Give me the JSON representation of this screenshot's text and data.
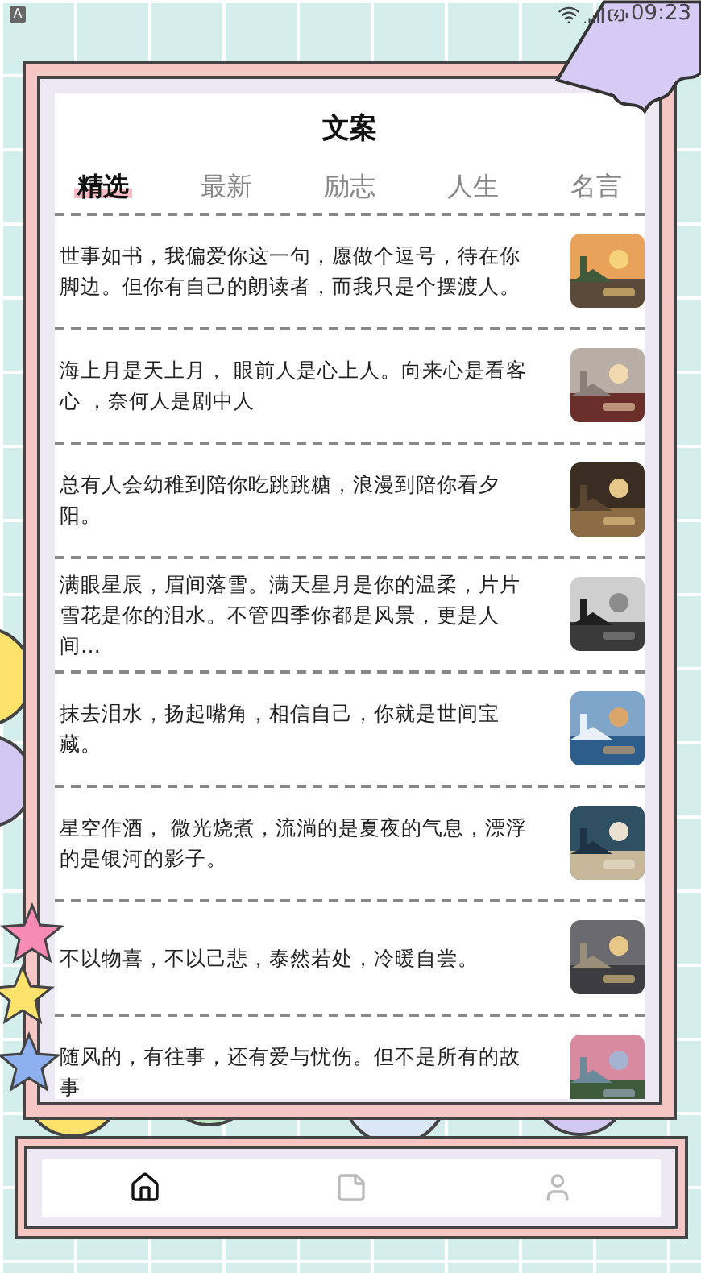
{
  "status_bar": {
    "notification": "A",
    "time": "09:23"
  },
  "title": "文案",
  "tabs": [
    {
      "label": "精选",
      "selected": true
    },
    {
      "label": "最新",
      "selected": false
    },
    {
      "label": "励志",
      "selected": false
    },
    {
      "label": "人生",
      "selected": false
    },
    {
      "label": "名言",
      "selected": false
    }
  ],
  "quotes": [
    {
      "text": "世事如书，我偏爱你这一句，愿做个逗号，待在你脚边。但你有自己的朗读者，而我只是个摆渡人。"
    },
    {
      "text": "海上月是天上月， 眼前人是心上人。向来心是看客心 ，奈何人是剧中人"
    },
    {
      "text": "总有人会幼稚到陪你吃跳跳糖，浪漫到陪你看夕阳。"
    },
    {
      "text": "满眼星辰，眉间落雪。满天星月是你的温柔，片片雪花是你的泪水。不管四季你都是风景，更是人间…"
    },
    {
      "text": "抹去泪水，扬起嘴角，相信自己，你就是世间宝藏。"
    },
    {
      "text": "星空作酒， 微光烧煮，流淌的是夏夜的气息，漂浮的是银河的影子。"
    },
    {
      "text": "不以物喜，不以己悲，泰然若处，冷暖自尝。"
    },
    {
      "text": "随风的，有往事，还有爱与忧伤。但不是所有的故事"
    }
  ],
  "bottom_nav": [
    {
      "kind": "home",
      "selected": true
    },
    {
      "kind": "notes",
      "selected": false
    },
    {
      "kind": "profile",
      "selected": false
    }
  ]
}
